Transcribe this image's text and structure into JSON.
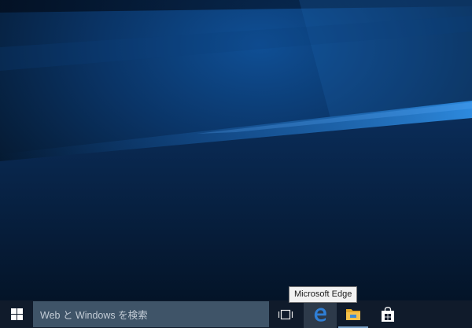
{
  "desktop": {
    "wallpaper": "Windows 10 hero wallpaper",
    "colors": {
      "base": "#051a33",
      "light_beam": "#2f8fe6",
      "glow": "#1c5fa6"
    }
  },
  "tooltip": {
    "text": "Microsoft Edge"
  },
  "taskbar": {
    "background": "#101b2b",
    "start": {
      "icon": "windows-logo-icon"
    },
    "search": {
      "placeholder": "Web と Windows を検索",
      "icon": "none"
    },
    "buttons": [
      {
        "name": "task-view",
        "icon": "task-view-icon"
      },
      {
        "name": "microsoft-edge",
        "icon": "edge-icon",
        "hovered": true,
        "accent": "#2f7fd6"
      },
      {
        "name": "file-explorer",
        "icon": "folder-icon",
        "accent": "#f3c04b"
      },
      {
        "name": "store",
        "icon": "store-icon",
        "accent": "#ffffff"
      }
    ]
  }
}
